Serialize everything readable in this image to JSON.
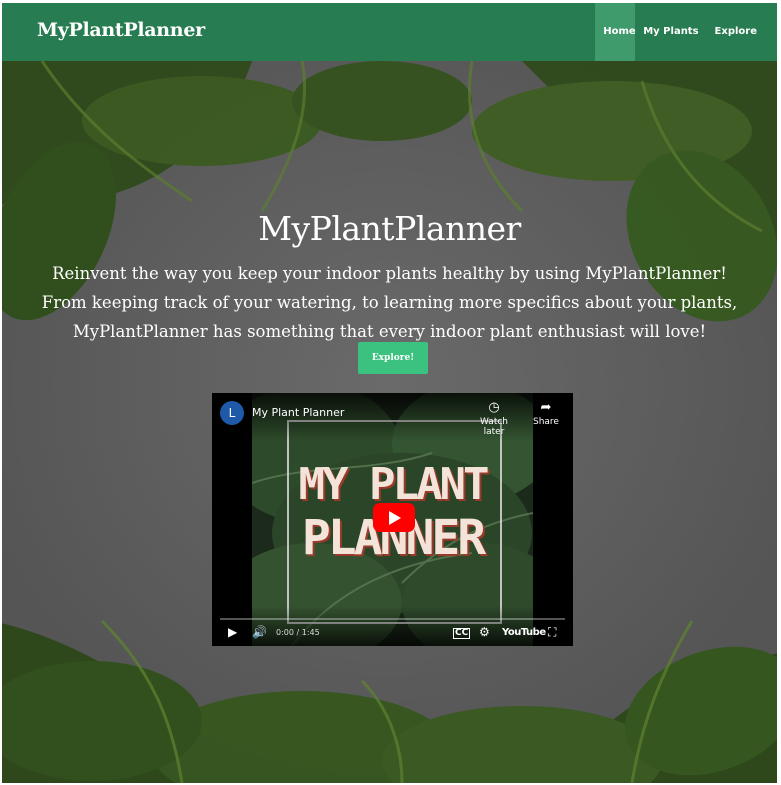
{
  "navbar": {
    "brand": "MyPlantPlanner",
    "links": [
      {
        "label": "Home",
        "active": true
      },
      {
        "label": "My Plants",
        "active": false
      },
      {
        "label": "Explore",
        "active": false
      }
    ],
    "color": "#277c51",
    "active_color": "#3f9a6c"
  },
  "hero": {
    "title": "MyPlantPlanner",
    "lines": [
      "Reinvent the way you keep your indoor plants healthy by using MyPlantPlanner!",
      "From keeping track of your watering, to learning more specifics about your plants,",
      "MyPlantPlanner has something that every indoor plant enthusiast will love!"
    ],
    "button_label": "Explore!",
    "button_color": "#3cc280"
  },
  "video": {
    "channel_initial": "L",
    "title": "My Plant Planner",
    "watch_later": "Watch later",
    "share": "Share",
    "overlay_line1": "MY PLANT",
    "overlay_line2": "PLANNER",
    "time": "0:00 / 1:45",
    "brand": "YouTube",
    "icons": [
      "clock-icon",
      "share-icon",
      "play-icon",
      "volume-icon",
      "captions-icon",
      "settings-icon",
      "fullscreen-icon"
    ]
  }
}
